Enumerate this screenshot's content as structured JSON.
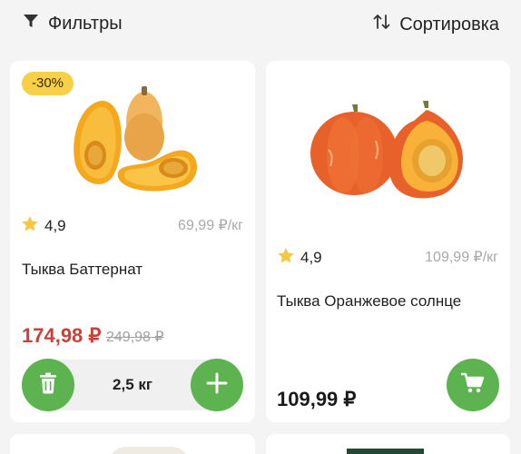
{
  "toolbar": {
    "filters_label": "Фильтры",
    "sort_label": "Сортировка",
    "filters_icon": "filter-funnel-icon",
    "sort_icon": "sort-arrows-icon"
  },
  "products": [
    {
      "discount_badge": "-30%",
      "image": "butternut-squash",
      "rating": "4,9",
      "unit_price": "69,99 ₽/кг",
      "title": "Тыква Баттернат",
      "price": "174,98 ₽",
      "old_price": "249,98 ₽",
      "quantity": "2,5 кг",
      "actions": [
        "trash-icon",
        "plus-icon"
      ]
    },
    {
      "image": "orange-sun-pumpkin",
      "rating": "4,9",
      "unit_price": "109,99 ₽/кг",
      "title": "Тыква Оранжевое солнце",
      "price": "109,99 ₽",
      "actions": [
        "cart-icon"
      ]
    }
  ],
  "colors": {
    "accent_green": "#5db34f",
    "sale_red": "#c8413b",
    "badge_yellow": "#f7d048",
    "star_yellow": "#f5c842"
  }
}
